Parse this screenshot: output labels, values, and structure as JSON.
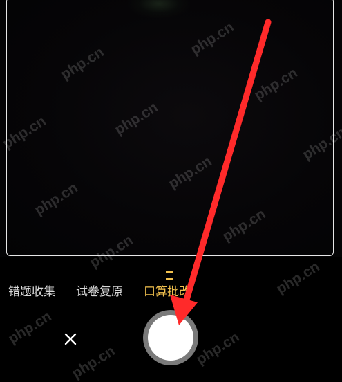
{
  "modes": [
    {
      "label": "错题收集",
      "active": false
    },
    {
      "label": "试卷复原",
      "active": false
    },
    {
      "label": "口算批改",
      "active": true
    }
  ],
  "controls": {
    "close_icon": "close-icon",
    "shutter": "shutter-button"
  },
  "watermark": {
    "text": "php.cn"
  },
  "colors": {
    "active_mode": "#f2c14e",
    "inactive_mode": "#d8d8d8",
    "annotation_arrow": "#ff2a2a",
    "frame": "#e6e6e6",
    "background": "#000000"
  }
}
